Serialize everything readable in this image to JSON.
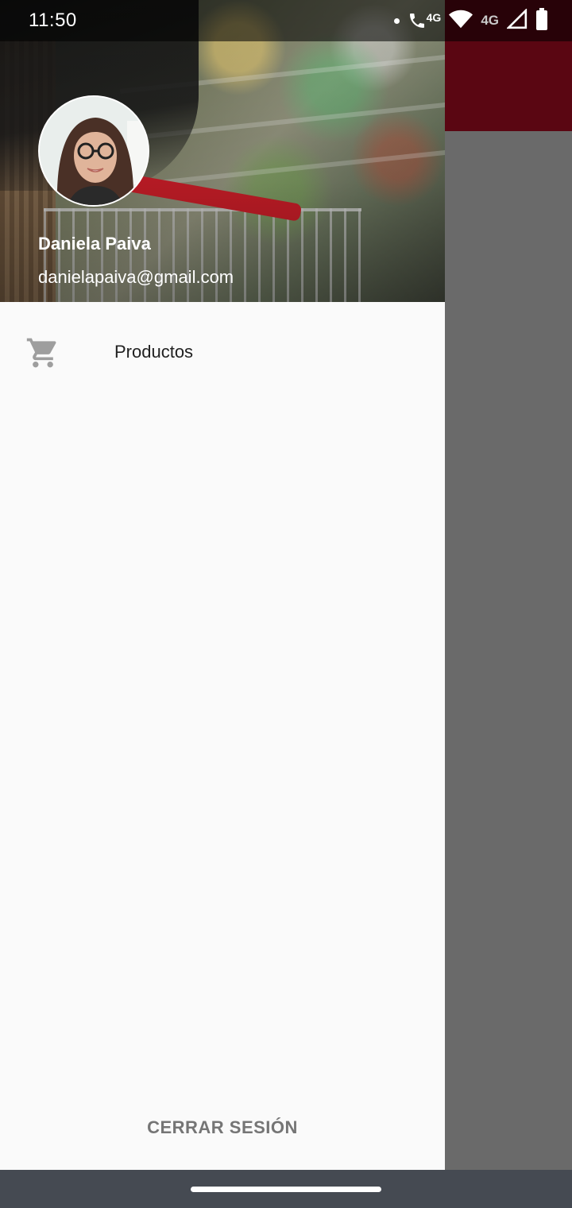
{
  "status_bar": {
    "time": "11:50",
    "call_network_label": "4G",
    "signal_network_label": "4G"
  },
  "drawer": {
    "header": {
      "user_name": "Daniela Paiva",
      "user_email": "danielapaiva@gmail.com"
    },
    "menu_items": [
      {
        "label": "Productos",
        "icon": "shopping-cart-icon"
      }
    ],
    "logout_label": "CERRAR SESIÓN"
  },
  "colors": {
    "toolbar_background": "#5a0612",
    "drawer_background": "#fafafa",
    "scrim": "#666666",
    "nav_bar": "#454a52",
    "menu_icon": "#9e9e9e",
    "logout_text": "#757575"
  }
}
